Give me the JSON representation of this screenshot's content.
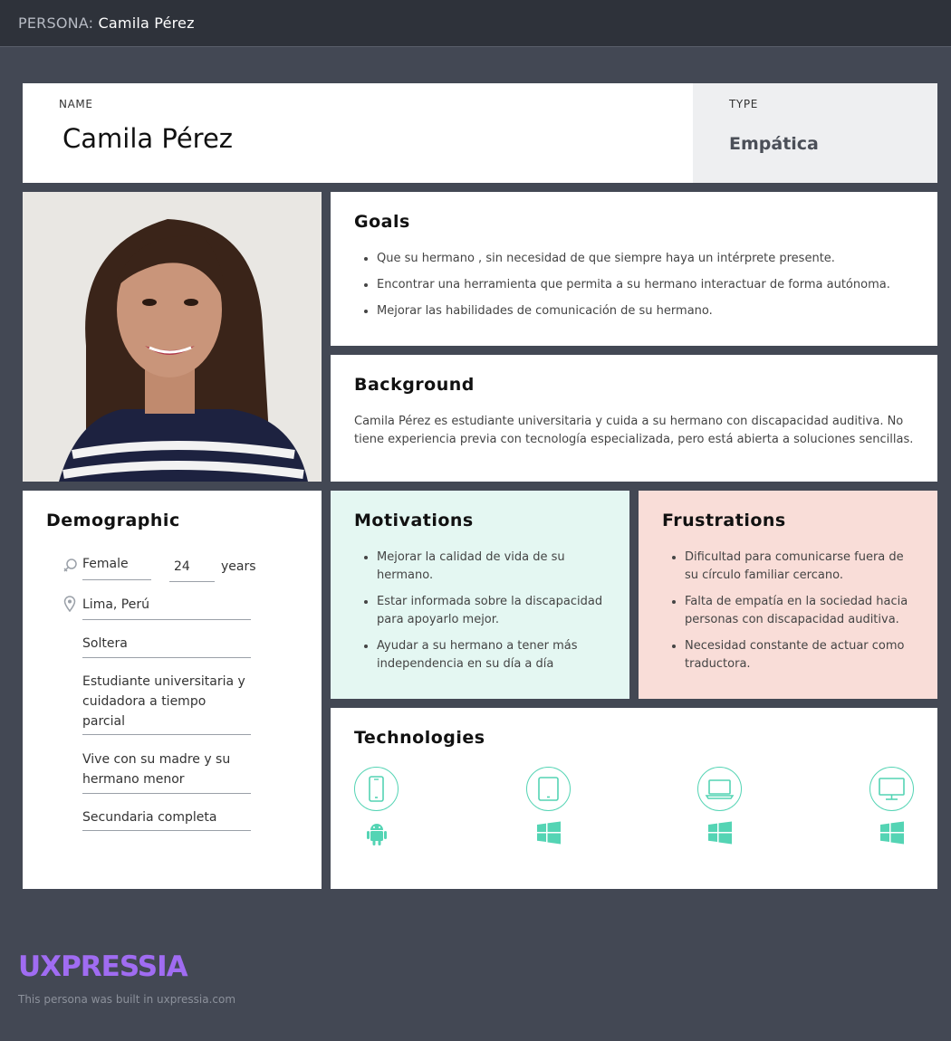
{
  "topbar": {
    "prefix": "PERSONA:",
    "name": "Camila Pérez"
  },
  "name_card": {
    "label": "NAME",
    "value": "Camila Pérez"
  },
  "type_card": {
    "label": "TYPE",
    "value": "Empática"
  },
  "goals": {
    "title": "Goals",
    "items": [
      "Que su hermano , sin necesidad de que siempre haya un intérprete presente.",
      "Encontrar una herramienta que permita a su hermano interactuar de forma autónoma.",
      "Mejorar las habilidades de comunicación de su hermano."
    ]
  },
  "background": {
    "title": "Background",
    "text": "Camila Pérez es estudiante universitaria y cuida a su hermano con discapacidad auditiva. No tiene experiencia previa con tecnología especializada, pero está abierta a soluciones sencillas."
  },
  "demographic": {
    "title": "Demographic",
    "gender": "Female",
    "age": "24",
    "age_unit": "years",
    "location": "Lima, Perú",
    "marital_status": "Soltera",
    "occupation": "Estudiante universitaria y cuidadora a tiempo parcial",
    "family": "Vive con su madre y su hermano menor",
    "education": "Secundaria completa"
  },
  "motivations": {
    "title": "Motivations",
    "items": [
      "Mejorar la calidad de vida de su hermano.",
      "Estar informada sobre la discapacidad para apoyarlo mejor.",
      "Ayudar a su hermano a tener más independencia en su día a día"
    ]
  },
  "frustrations": {
    "title": "Frustrations",
    "items": [
      "Dificultad para comunicarse  fuera de su círculo familiar cercano.",
      "Falta de empatía en la sociedad hacia personas con discapacidad auditiva.",
      "Necesidad constante de actuar como traductora."
    ]
  },
  "technologies": {
    "title": "Technologies",
    "devices": [
      {
        "device": "smartphone-icon",
        "os": "android-icon"
      },
      {
        "device": "tablet-icon",
        "os": "windows-icon"
      },
      {
        "device": "laptop-icon",
        "os": "windows-icon"
      },
      {
        "device": "desktop-icon",
        "os": "windows-icon"
      }
    ]
  },
  "footer": {
    "logo": "UXPRESSIA",
    "credit": "This persona was built in uxpressia.com"
  },
  "colors": {
    "background": "#434854",
    "topbar": "#2e323a",
    "accent": "#54d4b4",
    "motivations_bg": "#e4f7f2",
    "frustrations_bg": "#f9ddd8",
    "logo": "#a06cf2"
  }
}
